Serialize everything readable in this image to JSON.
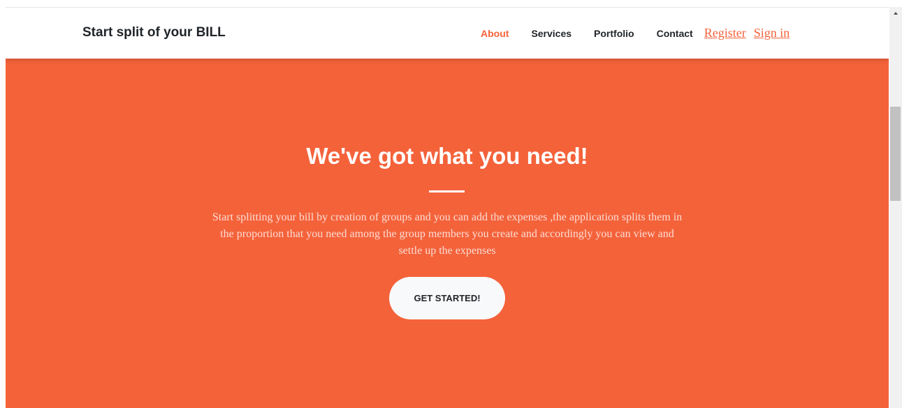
{
  "navbar": {
    "brand": "Start split of your BILL",
    "links": [
      {
        "label": "About",
        "active": true
      },
      {
        "label": "Services",
        "active": false
      },
      {
        "label": "Portfolio",
        "active": false
      },
      {
        "label": "Contact",
        "active": false
      }
    ],
    "auth": {
      "register": "Register",
      "signin": "Sign in"
    }
  },
  "hero": {
    "title": "We've got what you need!",
    "description": "Start splitting your bill by creation of groups and you can add the expenses ,the application splits them in the proportion that you need among the group members you create and accordingly you can view and settle up the expenses",
    "cta_label": "GET STARTED!"
  },
  "colors": {
    "primary": "#f4623a",
    "text_dark": "#212529",
    "button_bg": "#f8f9fa"
  }
}
